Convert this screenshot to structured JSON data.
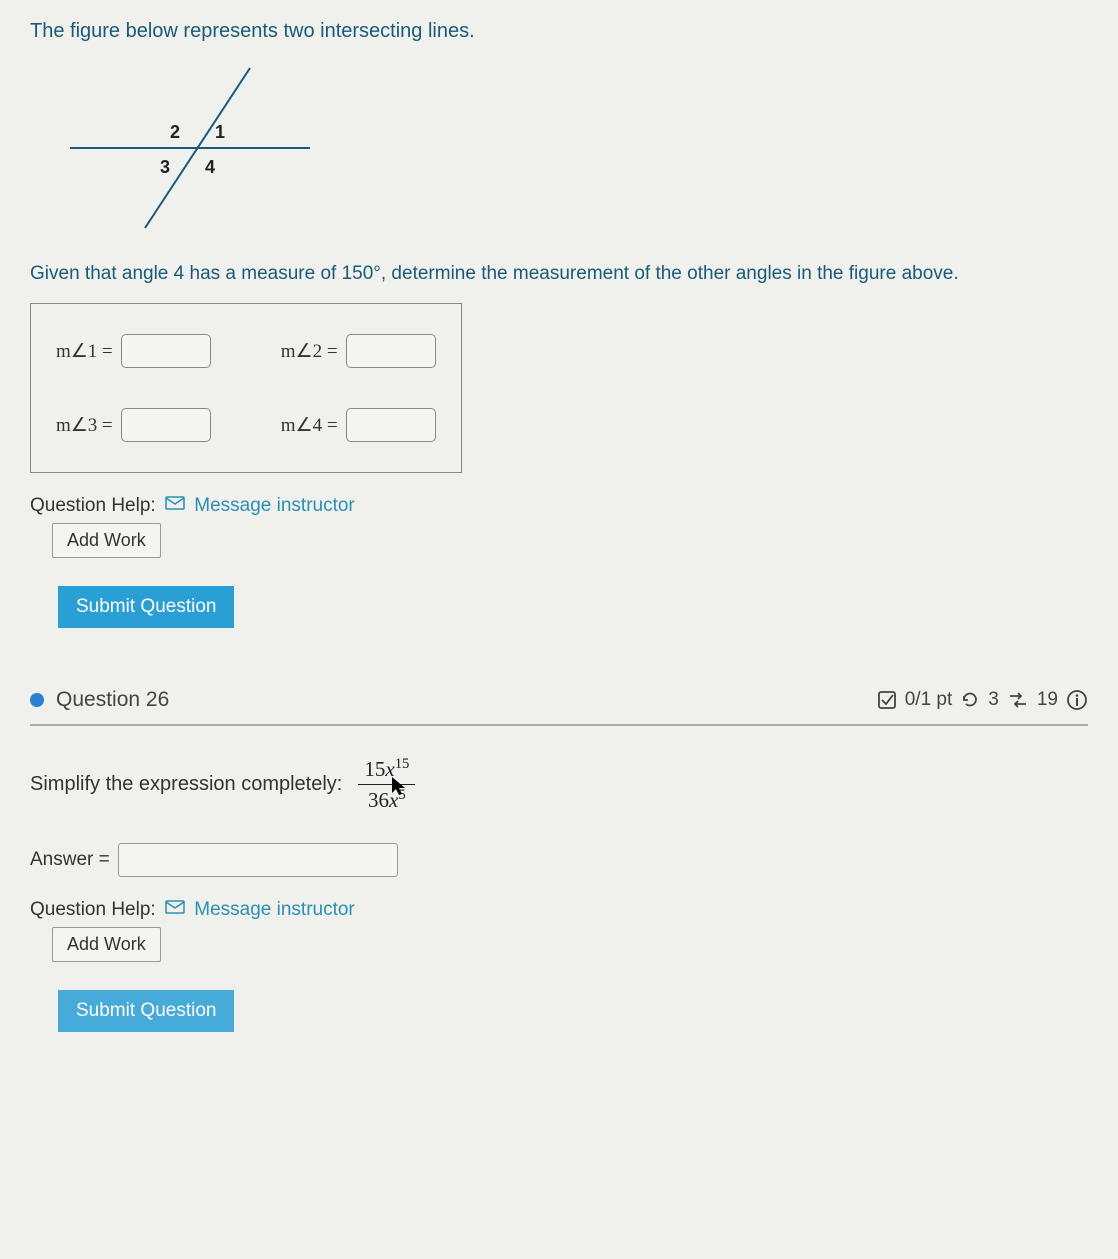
{
  "q25": {
    "intro": "The figure below represents two intersecting lines.",
    "figure_labels": {
      "a1": "1",
      "a2": "2",
      "a3": "3",
      "a4": "4"
    },
    "given": "Given that angle 4 has a measure of 150°, determine the measurement of the other angles in the figure above.",
    "angles": {
      "l1": "m∠1 =",
      "l2": "m∠2 =",
      "l3": "m∠3 =",
      "l4": "m∠4 =",
      "v1": "",
      "v2": "",
      "v3": "",
      "v4": ""
    },
    "help_label": "Question Help:",
    "message_instructor": "Message instructor",
    "add_work": "Add Work",
    "submit": "Submit Question"
  },
  "q26": {
    "title": "Question 26",
    "score": "0/1 pt",
    "retries": "3",
    "attempts": "19",
    "prompt": "Simplify the expression completely:",
    "frac_num_coef": "15",
    "frac_num_var": "x",
    "frac_num_exp": "15",
    "frac_den_coef": "36",
    "frac_den_var": "x",
    "frac_den_exp": "5",
    "answer_label": "Answer =",
    "answer_value": "",
    "help_label": "Question Help:",
    "message_instructor": "Message instructor",
    "add_work": "Add Work",
    "submit": "Submit Question"
  },
  "chart_data": {
    "type": "diagram",
    "description": "Two intersecting lines forming four angles labeled 1 (upper right), 2 (upper left), 3 (lower left), 4 (lower right). One line is horizontal, the other slanted upper-right to lower-left.",
    "labels": [
      "1",
      "2",
      "3",
      "4"
    ]
  }
}
